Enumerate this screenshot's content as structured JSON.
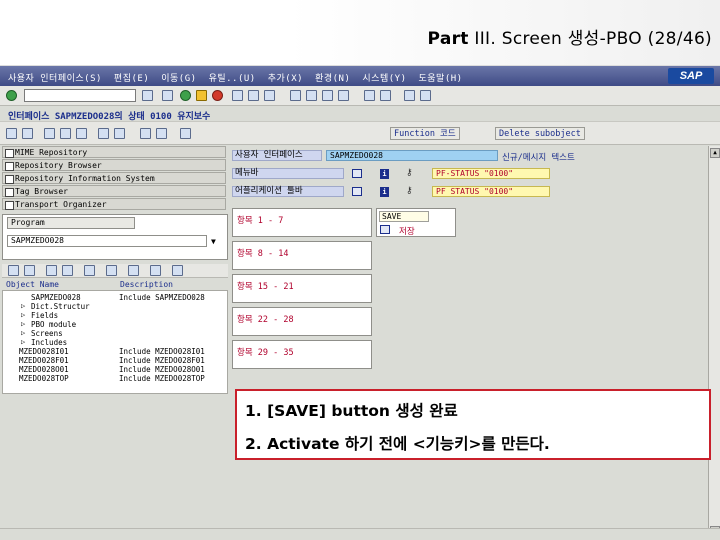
{
  "slide": {
    "title_bold": "Part",
    "title_rest": " III. Screen 생성-PBO (28/46)"
  },
  "menubar": {
    "items": [
      "사용자 인터페이스(S)",
      "편집(E)",
      "이동(G)",
      "유틸..(U)",
      "추가(X)",
      "환경(N)",
      "시스템(Y)",
      "도움말(H)"
    ],
    "logo": "SAP"
  },
  "toolbar": {
    "command_value": ""
  },
  "title": "인터페이스 SAPMZEDO028의 상태 0100 유지보수",
  "app_toolbar": {
    "function_code": "Function 코드",
    "delete_subobject": "Delete subobject"
  },
  "nav": {
    "items": [
      "MIME Repository",
      "Repository Browser",
      "Repository Information System",
      "Tag Browser",
      "Transport Organizer"
    ]
  },
  "object_panel": {
    "type_label": "Program",
    "program_value": "SAPMZEDO028"
  },
  "tree": {
    "headers": [
      "Object Name",
      "Description"
    ],
    "rows": [
      {
        "name": "SAPMZEDO028",
        "desc": "Include SAPMZEDO028"
      },
      {
        "name": "Dict.Structur",
        "desc": ""
      },
      {
        "name": "Fields",
        "desc": ""
      },
      {
        "name": "PBO module",
        "desc": ""
      },
      {
        "name": "Screens",
        "desc": ""
      },
      {
        "name": "Includes",
        "desc": ""
      },
      {
        "name": "MZEDO028I01",
        "desc": "Include MZEDO028I01"
      },
      {
        "name": "MZEDO028F01",
        "desc": "Include MZEDO028F01"
      },
      {
        "name": "MZEDO028O01",
        "desc": "Include MZEDO028O01"
      },
      {
        "name": "MZEDO028TOP",
        "desc": "Include MZEDO028TOP"
      }
    ]
  },
  "right": {
    "ui_label": "사용자 인터페이스",
    "ui_value": "SAPMZEDO028",
    "ui_suffix": "신규/메시지 텍스트",
    "menubar_label": "메뉴바",
    "menubar_status": "PF-STATUS \"0100\"",
    "apptb_label": "어플리케이션 툴바",
    "apptb_status": "PF STATUS \"0100\"",
    "items": [
      "항목 1 - 7",
      "항목 8 - 14",
      "항목 15 - 21",
      "항목 22 - 28",
      "항목 29 - 35"
    ],
    "save_field": "SAVE",
    "save_caption": "저장"
  },
  "callout": {
    "line1": "1. [SAVE] button 생성 완료",
    "line2": "2. Activate 하기 전에 <기능키>를 만든다."
  }
}
